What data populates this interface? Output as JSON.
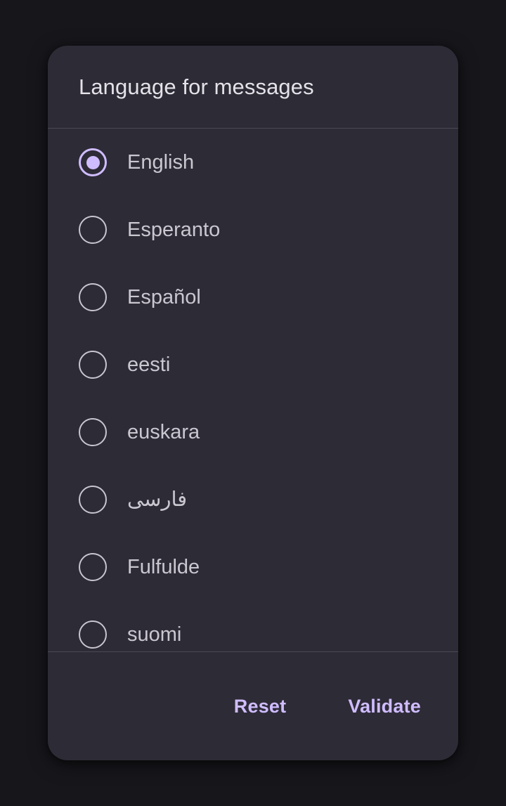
{
  "colors": {
    "scrim": "#17161B",
    "dialog_surface": "#2D2B36",
    "title_text": "#E4E1E8",
    "option_text": "#CAC7D0",
    "accent": "#CFBCFF",
    "radio_unselected": "#C8C5CF",
    "divider": "#4A4852"
  },
  "dialog": {
    "title": "Language for messages",
    "options": [
      {
        "label": "English",
        "selected": true,
        "rtl": false
      },
      {
        "label": "Esperanto",
        "selected": false,
        "rtl": false
      },
      {
        "label": "Español",
        "selected": false,
        "rtl": false
      },
      {
        "label": "eesti",
        "selected": false,
        "rtl": false
      },
      {
        "label": "euskara",
        "selected": false,
        "rtl": false
      },
      {
        "label": "فارسی",
        "selected": false,
        "rtl": true
      },
      {
        "label": "Fulfulde",
        "selected": false,
        "rtl": false
      },
      {
        "label": "suomi",
        "selected": false,
        "rtl": false
      }
    ],
    "footer": {
      "reset_label": "Reset",
      "validate_label": "Validate"
    }
  }
}
